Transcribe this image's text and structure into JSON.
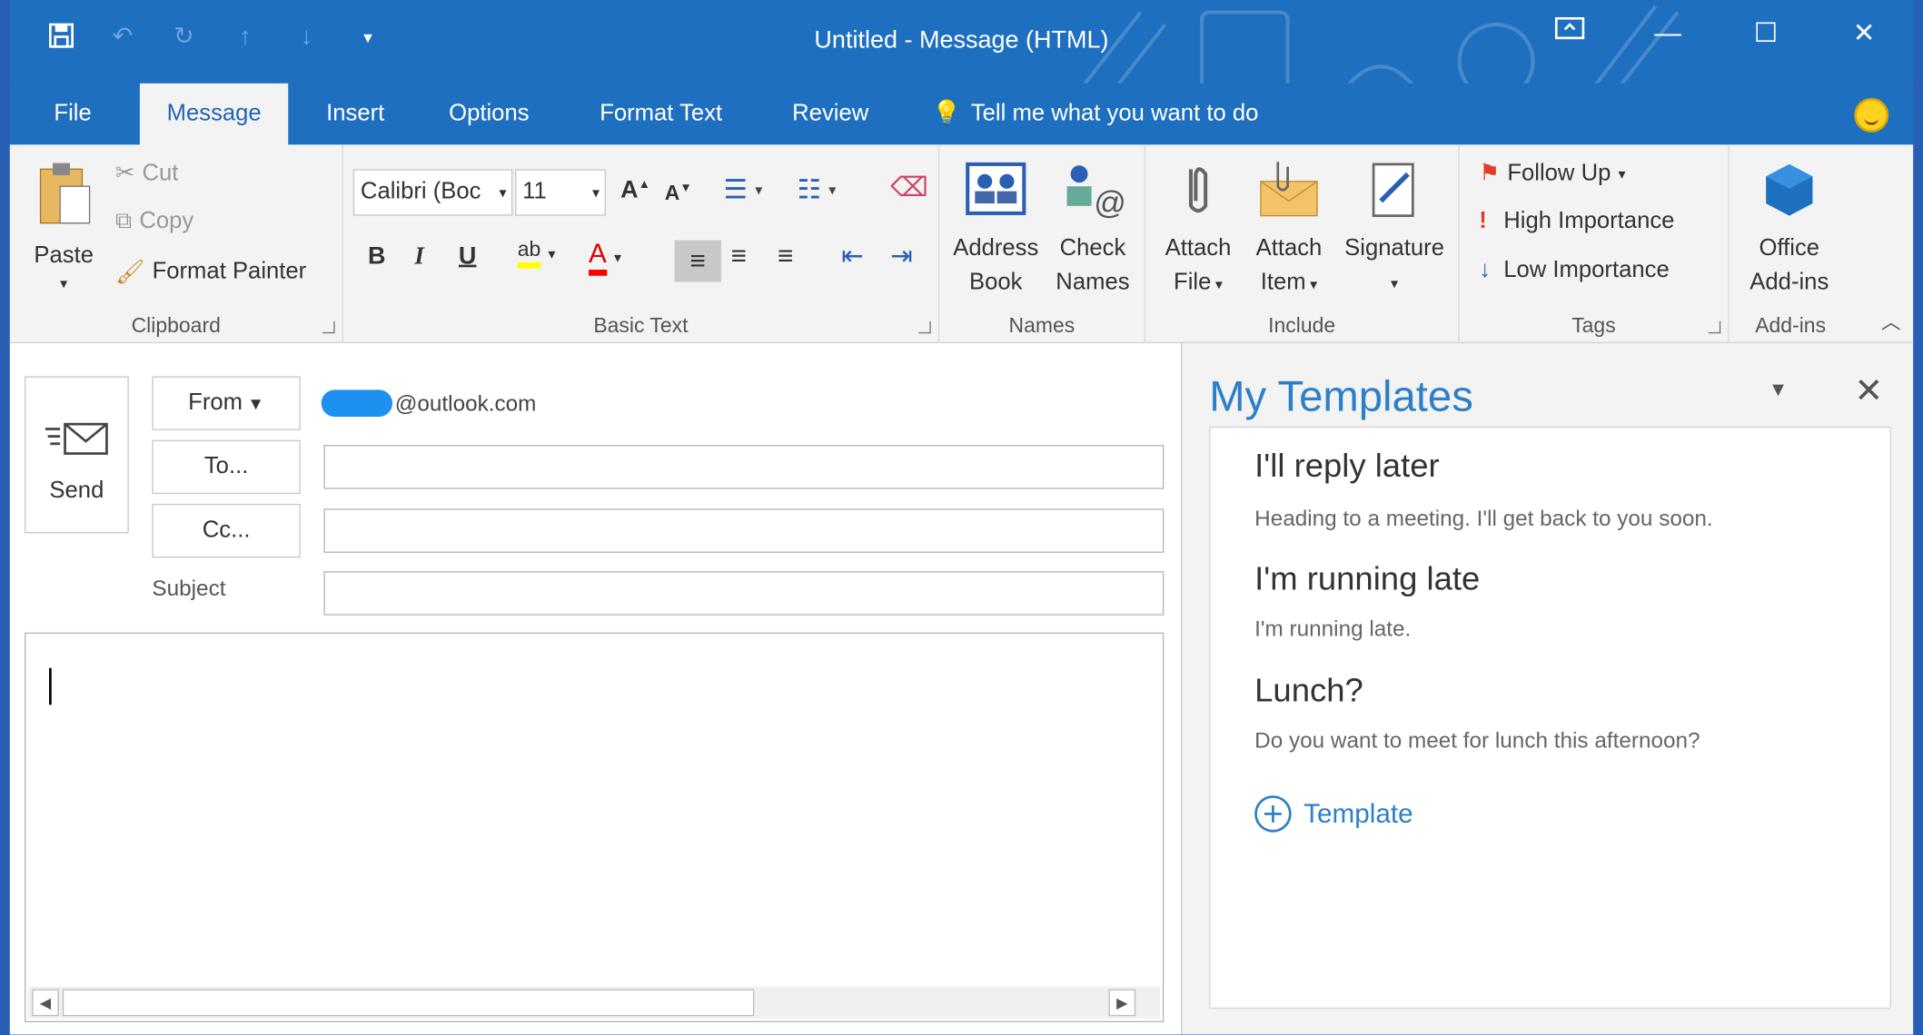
{
  "window": {
    "title": "Untitled  -  Message (HTML)"
  },
  "tabs": [
    "File",
    "Message",
    "Insert",
    "Options",
    "Format Text",
    "Review"
  ],
  "tell_me": "Tell me what you want to do",
  "ribbon": {
    "clipboard": {
      "paste": "Paste",
      "cut": "Cut",
      "copy": "Copy",
      "format_painter": "Format Painter",
      "label": "Clipboard"
    },
    "basic_text": {
      "font": "Calibri (Boc",
      "size": "11",
      "bold": "B",
      "italic": "I",
      "underline": "U",
      "label": "Basic Text"
    },
    "names": {
      "address_book_1": "Address",
      "address_book_2": "Book",
      "check_names_1": "Check",
      "check_names_2": "Names",
      "label": "Names"
    },
    "include": {
      "attach_file_1": "Attach",
      "attach_file_2": "File",
      "attach_item_1": "Attach",
      "attach_item_2": "Item",
      "signature": "Signature",
      "label": "Include"
    },
    "tags": {
      "follow_up": "Follow Up",
      "high": "High Importance",
      "low": "Low Importance",
      "label": "Tags"
    },
    "addins": {
      "office_1": "Office",
      "office_2": "Add-ins",
      "label": "Add-ins"
    }
  },
  "compose": {
    "send": "Send",
    "from_btn": "From",
    "from_addr": "@outlook.com",
    "to_btn": "To...",
    "cc_btn": "Cc...",
    "subject_label": "Subject",
    "to_value": "",
    "cc_value": "",
    "subject_value": ""
  },
  "templates": {
    "title": "My Templates",
    "items": [
      {
        "name": "I'll reply later",
        "text": "Heading to a meeting. I'll get back to you soon."
      },
      {
        "name": "I'm running late",
        "text": "I'm running late."
      },
      {
        "name": "Lunch?",
        "text": "Do you want to meet for lunch this afternoon?"
      }
    ],
    "add_label": "Template"
  },
  "colors": {
    "accent": "#1f6fc0",
    "link": "#2d7fc7",
    "highlight": "#ffff00",
    "font_color": "#ff0000",
    "follow_flag": "#e03b2b"
  }
}
